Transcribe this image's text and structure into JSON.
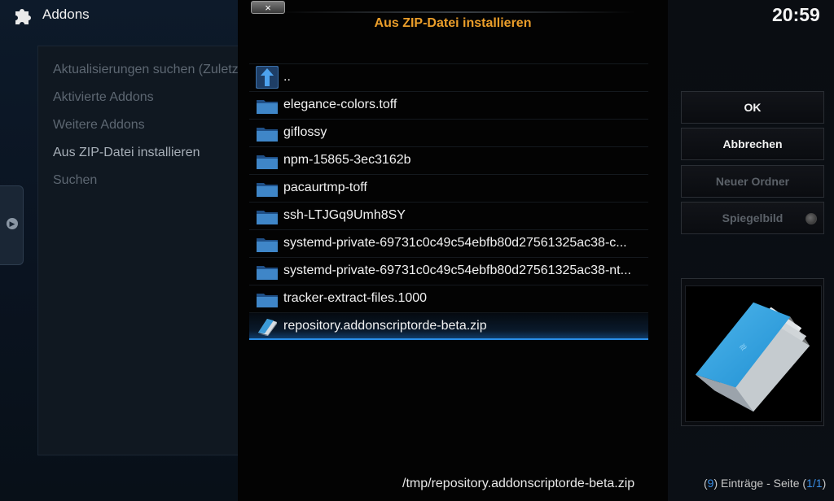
{
  "header": {
    "title": "Addons",
    "icon": "puzzle-icon"
  },
  "clock": "20:59",
  "sidebar": {
    "items": [
      {
        "label": "Aktualisierungen suchen (Zuletzt"
      },
      {
        "label": "Aktivierte Addons"
      },
      {
        "label": "Weitere Addons"
      },
      {
        "label": "Aus ZIP-Datei installieren"
      },
      {
        "label": "Suchen"
      }
    ]
  },
  "dialog": {
    "title": "Aus ZIP-Datei installieren",
    "close_label": "×",
    "items": [
      {
        "label": "..",
        "icon": "parent-folder-icon"
      },
      {
        "label": "elegance-colors.toff",
        "icon": "folder-icon"
      },
      {
        "label": "giflossy",
        "icon": "folder-icon"
      },
      {
        "label": "npm-15865-3ec3162b",
        "icon": "folder-icon"
      },
      {
        "label": "pacaurtmp-toff",
        "icon": "folder-icon"
      },
      {
        "label": "ssh-LTJGq9Umh8SY",
        "icon": "folder-icon"
      },
      {
        "label": "systemd-private-69731c0c49c54ebfb80d27561325ac38-c...",
        "icon": "folder-icon"
      },
      {
        "label": "systemd-private-69731c0c49c54ebfb80d27561325ac38-nt...",
        "icon": "folder-icon"
      },
      {
        "label": "tracker-extract-files.1000",
        "icon": "folder-icon"
      },
      {
        "label": "repository.addonscriptorde-beta.zip",
        "icon": "zip-file-icon",
        "selected": true
      }
    ],
    "path": "/tmp/repository.addonscriptorde-beta.zip"
  },
  "buttons": {
    "ok": "OK",
    "cancel": "Abbrechen",
    "new_folder": "Neuer Ordner",
    "mirror": "Spiegelbild"
  },
  "footer": {
    "count": "9",
    "entries_text": "Einträge - Seite",
    "page": "1/1"
  },
  "colors": {
    "title_accent": "#eb9e2a",
    "selection": "#2a8ee8",
    "folder": "#3f86c8"
  }
}
